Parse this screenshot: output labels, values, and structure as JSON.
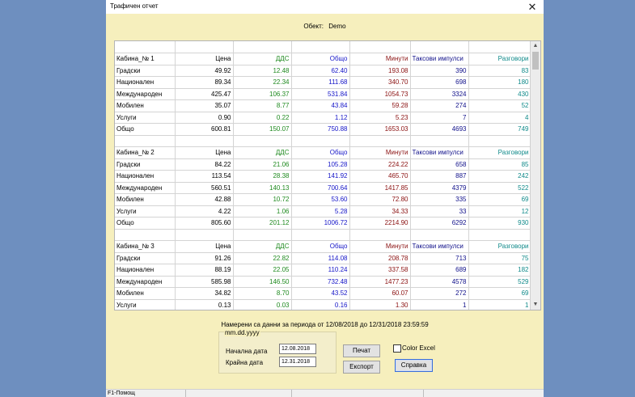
{
  "window": {
    "title": "Трафичен отчет",
    "close_glyph": "✕"
  },
  "object": {
    "label": "Обект:",
    "value": "Demo"
  },
  "columns": [
    "Цена",
    "ДДС",
    "Общо",
    "Минути",
    "Таксови импулси",
    "Разговори"
  ],
  "blocks": [
    {
      "name": "Кабина_№  1",
      "rows": [
        [
          "Градски",
          "49.92",
          "12.48",
          "62.40",
          "193.08",
          "390",
          "83"
        ],
        [
          "Национален",
          "89.34",
          "22.34",
          "111.68",
          "340.70",
          "698",
          "180"
        ],
        [
          "Международен",
          "425.47",
          "106.37",
          "531.84",
          "1054.73",
          "3324",
          "430"
        ],
        [
          "Мобилен",
          "35.07",
          "8.77",
          "43.84",
          "59.28",
          "274",
          "52"
        ],
        [
          "Услуги",
          "0.90",
          "0.22",
          "1.12",
          "5.23",
          "7",
          "4"
        ],
        [
          "Общо",
          "600.81",
          "150.07",
          "750.88",
          "1653.03",
          "4693",
          "749"
        ]
      ]
    },
    {
      "name": "Кабина_№  2",
      "rows": [
        [
          "Градски",
          "84.22",
          "21.06",
          "105.28",
          "224.22",
          "658",
          "85"
        ],
        [
          "Национален",
          "113.54",
          "28.38",
          "141.92",
          "465.70",
          "887",
          "242"
        ],
        [
          "Международен",
          "560.51",
          "140.13",
          "700.64",
          "1417.85",
          "4379",
          "522"
        ],
        [
          "Мобилен",
          "42.88",
          "10.72",
          "53.60",
          "72.80",
          "335",
          "69"
        ],
        [
          "Услуги",
          "4.22",
          "1.06",
          "5.28",
          "34.33",
          "33",
          "12"
        ],
        [
          "Общо",
          "805.60",
          "201.12",
          "1006.72",
          "2214.90",
          "6292",
          "930"
        ]
      ]
    },
    {
      "name": "Кабина_№  3",
      "rows": [
        [
          "Градски",
          "91.26",
          "22.82",
          "114.08",
          "208.78",
          "713",
          "75"
        ],
        [
          "Национален",
          "88.19",
          "22.05",
          "110.24",
          "337.58",
          "689",
          "182"
        ],
        [
          "Международен",
          "585.98",
          "146.50",
          "732.48",
          "1477.23",
          "4578",
          "529"
        ],
        [
          "Мобилен",
          "34.82",
          "8.70",
          "43.52",
          "60.07",
          "272",
          "69"
        ],
        [
          "Услуги",
          "0.13",
          "0.03",
          "0.16",
          "1.30",
          "1",
          "1"
        ]
      ]
    }
  ],
  "period": {
    "prefix": "Намерени са данни за периода от",
    "from": "12/08/2018",
    "to_word": "до",
    "to": "12/31/2018 23:59:59"
  },
  "dates": {
    "group_title": "mm.dd.yyyy",
    "start_label": "Начална дата",
    "start_value": "12.08.2018",
    "end_label": "Крайна дата",
    "end_value": "12.31.2018"
  },
  "buttons": {
    "print": "Печат",
    "export": "Експорт",
    "help": "Справка"
  },
  "color_excel": {
    "label": "Color Excel",
    "checked": false
  },
  "status": {
    "help": "F1-Помощ"
  },
  "scroll_icons": {
    "up": "up-arrow-icon",
    "down": "down-arrow-icon"
  }
}
